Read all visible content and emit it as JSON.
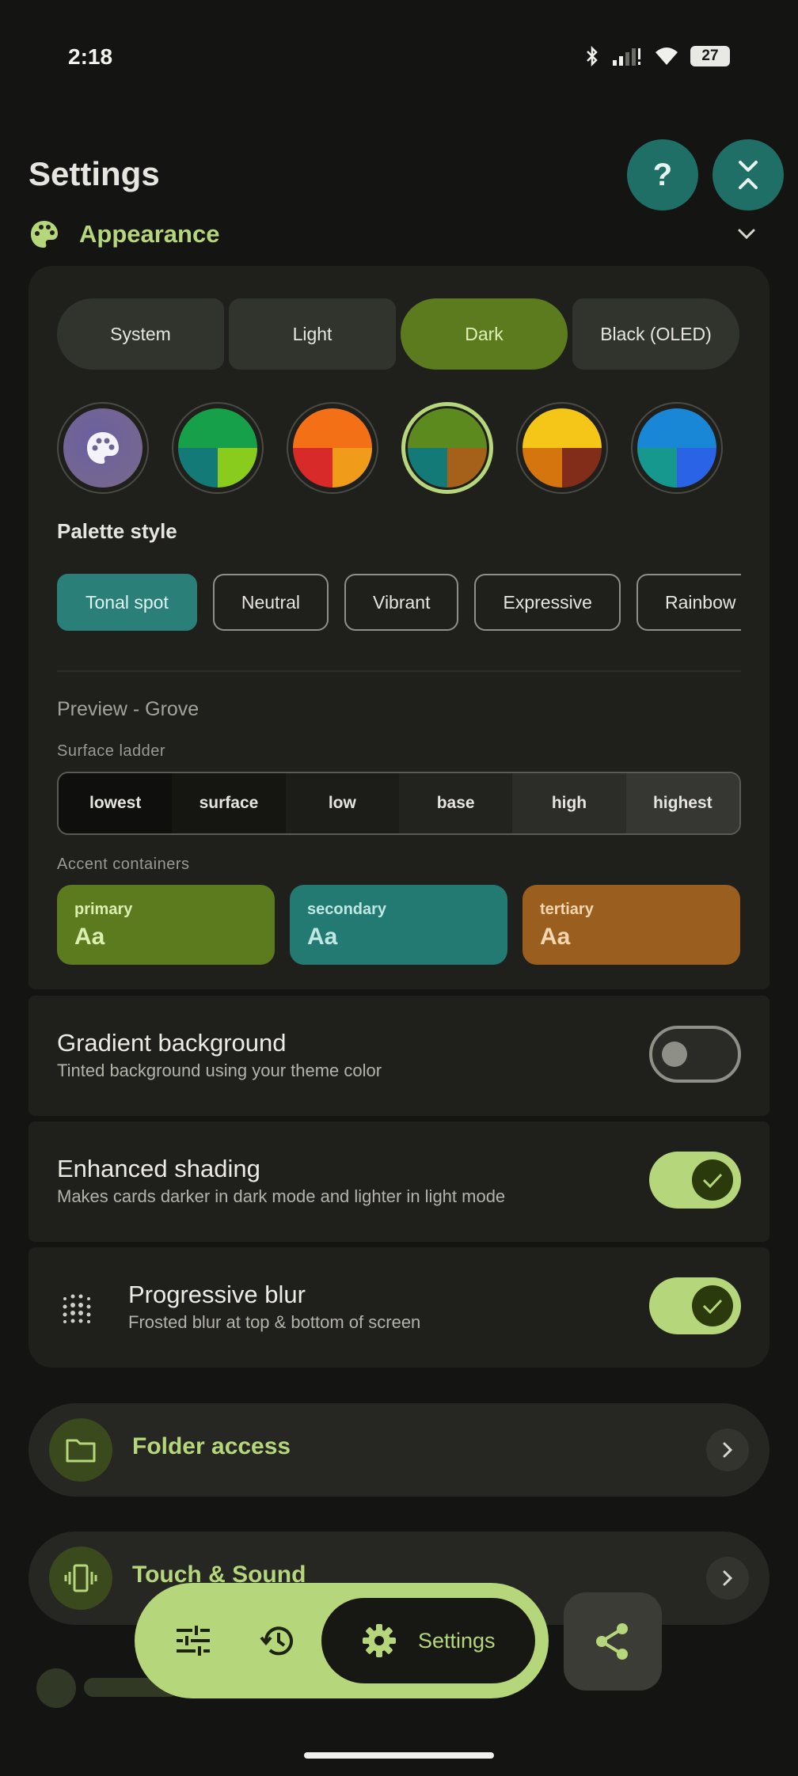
{
  "status_bar": {
    "time": "2:18",
    "battery": "27"
  },
  "header": {
    "title": "Settings",
    "help_label": "?"
  },
  "appearance": {
    "section_title": "Appearance",
    "theme_modes": [
      "System",
      "Light",
      "Dark",
      "Black (OLED)"
    ],
    "selected_mode": "Dark",
    "swatches": [
      {
        "name": "dynamic",
        "top": "#6e5f9a",
        "bottom_left": "#6e5f9a",
        "bottom_right": "#6e5f9a"
      },
      {
        "name": "green",
        "top": "#17a04a",
        "bottom_left": "#147a78",
        "bottom_right": "#8acc1e"
      },
      {
        "name": "orange",
        "top": "#f37017",
        "bottom_left": "#d92a2a",
        "bottom_right": "#f19b1b"
      },
      {
        "name": "grove",
        "top": "#5c8a1e",
        "bottom_left": "#147a78",
        "bottom_right": "#a5601a"
      },
      {
        "name": "yellow",
        "top": "#f5c518",
        "bottom_left": "#d4760d",
        "bottom_right": "#822d1a"
      },
      {
        "name": "blue",
        "top": "#1a86d6",
        "bottom_left": "#17988e",
        "bottom_right": "#2a63e6"
      }
    ],
    "palette_style_label": "Palette style",
    "palette_styles": [
      "Tonal spot",
      "Neutral",
      "Vibrant",
      "Expressive",
      "Rainbow"
    ],
    "preview_title": "Preview - Grove",
    "surface_ladder_label": "Surface ladder",
    "surface_ladder": [
      {
        "label": "lowest",
        "color": "#0f100d"
      },
      {
        "label": "surface",
        "color": "#151612"
      },
      {
        "label": "low",
        "color": "#1c1d19"
      },
      {
        "label": "base",
        "color": "#22231f"
      },
      {
        "label": "high",
        "color": "#2c2d29"
      },
      {
        "label": "highest",
        "color": "#363733"
      }
    ],
    "accent_containers_label": "Accent containers",
    "accents": [
      {
        "name": "primary",
        "sample": "Aa",
        "bg": "#5c7a1e",
        "fg": "#dbefb0"
      },
      {
        "name": "secondary",
        "sample": "Aa",
        "bg": "#227a72",
        "fg": "#bfe8e2"
      },
      {
        "name": "tertiary",
        "sample": "Aa",
        "bg": "#9a5f1e",
        "fg": "#f5d6b0"
      }
    ]
  },
  "toggles": {
    "gradient": {
      "title": "Gradient background",
      "subtitle": "Tinted background using your theme color",
      "on": false
    },
    "shading": {
      "title": "Enhanced shading",
      "subtitle": "Makes cards darker in dark mode and lighter in light mode",
      "on": true
    },
    "blur": {
      "title": "Progressive blur",
      "subtitle": "Frosted blur at top & bottom of screen",
      "on": true
    }
  },
  "nav_rows": {
    "folder": "Folder access",
    "touch": "Touch & Sound"
  },
  "bottom_bar": {
    "settings_label": "Settings"
  },
  "colors": {
    "accent": "#b5d67a",
    "teal": "#1f6f66",
    "background": "#141512",
    "card": "#1f201c"
  }
}
